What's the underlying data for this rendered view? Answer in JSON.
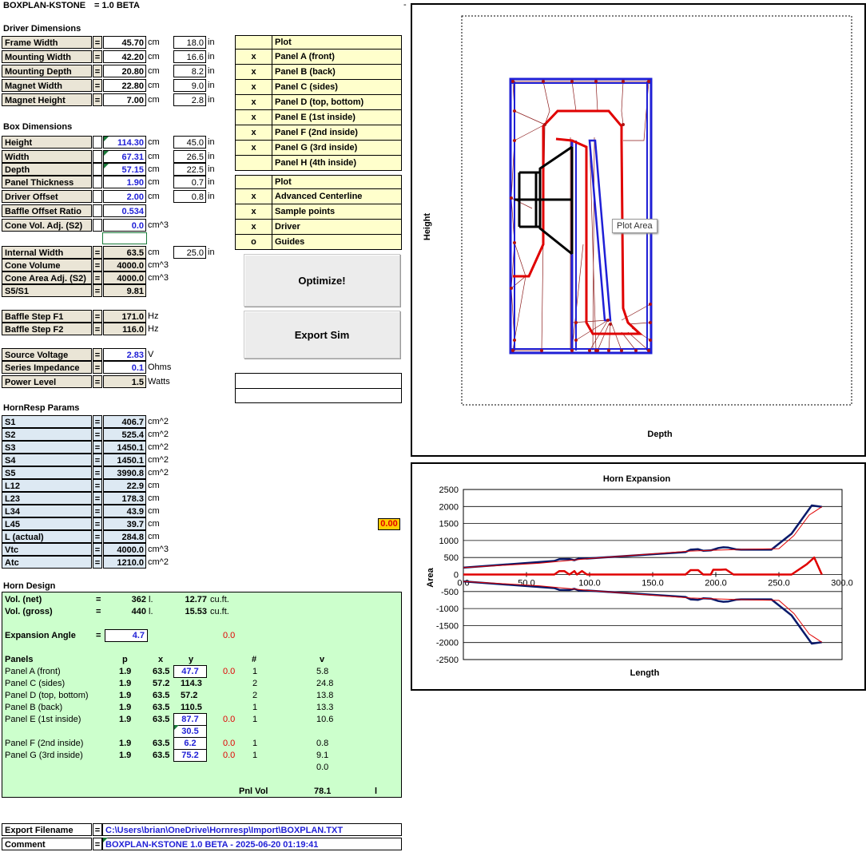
{
  "title": {
    "app": "BOXPLAN-KSTONE",
    "version": "= 1.0 BETA",
    "dash": "-"
  },
  "driver": {
    "heading": "Driver Dimensions",
    "rows": [
      {
        "label": "Frame Width",
        "eq": "=",
        "cm": "45.70",
        "unit": "cm",
        "inch": "18.0",
        "unit2": "in"
      },
      {
        "label": "Mounting Width",
        "eq": "=",
        "cm": "42.20",
        "unit": "cm",
        "inch": "16.6",
        "unit2": "in"
      },
      {
        "label": "Mounting Depth",
        "eq": "=",
        "cm": "20.80",
        "unit": "cm",
        "inch": "8.2",
        "unit2": "in"
      },
      {
        "label": "Magnet Width",
        "eq": "=",
        "cm": "22.80",
        "unit": "cm",
        "inch": "9.0",
        "unit2": "in"
      },
      {
        "label": "Magnet Height",
        "eq": "=",
        "cm": "7.00",
        "unit": "cm",
        "inch": "2.8",
        "unit2": "in"
      }
    ]
  },
  "box": {
    "heading": "Box Dimensions",
    "rows": [
      {
        "label": "Height",
        "cm": "114.30",
        "unit": "cm",
        "inch": "45.0",
        "unit2": "in"
      },
      {
        "label": "Width",
        "cm": "67.31",
        "unit": "cm",
        "inch": "26.5",
        "unit2": "in"
      },
      {
        "label": "Depth",
        "cm": "57.15",
        "unit": "cm",
        "inch": "22.5",
        "unit2": "in"
      },
      {
        "label": "Panel Thickness",
        "cm": "1.90",
        "unit": "cm",
        "inch": "0.7",
        "unit2": "in"
      },
      {
        "label": "Driver Offset",
        "cm": "2.00",
        "unit": "cm",
        "inch": "0.8",
        "unit2": "in"
      },
      {
        "label": "Baffle Offset Ratio",
        "cm": "0.534",
        "unit": "",
        "inch": "",
        "unit2": ""
      },
      {
        "label": "Cone Vol. Adj. (S2)",
        "cm": "0.0",
        "unit": "cm^3",
        "inch": "",
        "unit2": ""
      }
    ]
  },
  "derived": [
    {
      "label": "Internal Width",
      "eq": "=",
      "val": "63.5",
      "unit": "cm",
      "inch": "25.0",
      "unit2": "in"
    },
    {
      "label": "Cone Volume",
      "eq": "=",
      "val": "4000.0",
      "unit": "cm^3"
    },
    {
      "label": "Cone Area Adj. (S2)",
      "eq": "=",
      "val": "4000.0",
      "unit": "cm^3"
    },
    {
      "label": "S5/S1",
      "eq": "=",
      "val": "9.81",
      "unit": ""
    }
  ],
  "baffle": [
    {
      "label": "Baffle Step F1",
      "eq": "=",
      "val": "171.0",
      "unit": "Hz"
    },
    {
      "label": "Baffle Step F2",
      "eq": "=",
      "val": "116.0",
      "unit": "Hz"
    }
  ],
  "electrical": [
    {
      "label": "Source Voltage",
      "eq": "=",
      "val": "2.83",
      "unit": "V"
    },
    {
      "label": "Series Impedance",
      "eq": "=",
      "val": "0.1",
      "unit": "Ohms"
    },
    {
      "label": "Power Level",
      "eq": "=",
      "val": "1.5",
      "unit": "Watts"
    }
  ],
  "hornresp": {
    "heading": "HornResp Params",
    "rows": [
      {
        "label": "S1",
        "eq": "=",
        "val": "406.7",
        "unit": "cm^2"
      },
      {
        "label": "S2",
        "eq": "=",
        "val": "525.4",
        "unit": "cm^2"
      },
      {
        "label": "S3",
        "eq": "=",
        "val": "1450.1",
        "unit": "cm^2"
      },
      {
        "label": "S4",
        "eq": "=",
        "val": "1450.1",
        "unit": "cm^2"
      },
      {
        "label": "S5",
        "eq": "=",
        "val": "3990.8",
        "unit": "cm^2"
      },
      {
        "label": "L12",
        "eq": "=",
        "val": "22.9",
        "unit": "cm"
      },
      {
        "label": "L23",
        "eq": "=",
        "val": "178.3",
        "unit": "cm"
      },
      {
        "label": "L34",
        "eq": "=",
        "val": "43.9",
        "unit": "cm"
      },
      {
        "label": "L45",
        "eq": "=",
        "val": "39.7",
        "unit": "cm"
      },
      {
        "label": "L (actual)",
        "eq": "=",
        "val": "284.8",
        "unit": "cm"
      },
      {
        "label": "Vtc",
        "eq": "=",
        "val": "4000.0",
        "unit": "cm^3"
      },
      {
        "label": "Atc",
        "eq": "=",
        "val": "1210.0",
        "unit": "cm^2"
      }
    ],
    "badge": "0.00"
  },
  "plot1": {
    "heading": "Plot",
    "rows": [
      {
        "mark": "x",
        "label": "Panel A (front)"
      },
      {
        "mark": "x",
        "label": "Panel B (back)"
      },
      {
        "mark": "x",
        "label": "Panel C (sides)"
      },
      {
        "mark": "x",
        "label": "Panel D (top, bottom)"
      },
      {
        "mark": "x",
        "label": "Panel E (1st inside)"
      },
      {
        "mark": "x",
        "label": "Panel F (2nd inside)"
      },
      {
        "mark": "x",
        "label": "Panel G (3rd inside)"
      },
      {
        "mark": "",
        "label": "Panel H (4th inside)"
      }
    ]
  },
  "plot2": {
    "heading": "Plot",
    "rows": [
      {
        "mark": "x",
        "label": "Advanced Centerline"
      },
      {
        "mark": "x",
        "label": "Sample points"
      },
      {
        "mark": "x",
        "label": "Driver"
      },
      {
        "mark": "o",
        "label": "Guides"
      }
    ]
  },
  "buttons": {
    "optimize": "Optimize!",
    "export": "Export Sim"
  },
  "horn_design": {
    "heading": "Horn Design",
    "vol_net": {
      "label": "Vol. (net)",
      "eq": "=",
      "l": "362",
      "lu": "l.",
      "ft": "12.77",
      "ftu": "cu.ft."
    },
    "vol_gross": {
      "label": "Vol. (gross)",
      "eq": "=",
      "l": "440",
      "lu": "l.",
      "ft": "15.53",
      "ftu": "cu.ft."
    },
    "angle": {
      "label": "Expansion Angle",
      "eq": "=",
      "val": "4.7",
      "delta": "0.0"
    },
    "cols": {
      "panels": "Panels",
      "p": "p",
      "x": "x",
      "y": "y",
      "n": "#",
      "v": "v"
    },
    "panels": [
      {
        "name": "Panel A (front)",
        "p": "1.9",
        "x": "63.5",
        "y": "47.7",
        "d": "0.0",
        "n": "1",
        "v": "5.8",
        "edit": true
      },
      {
        "name": "Panel C (sides)",
        "p": "1.9",
        "x": "57.2",
        "y": "114.3",
        "d": "",
        "n": "2",
        "v": "24.8",
        "edit": false
      },
      {
        "name": "Panel D (top, bottom)",
        "p": "1.9",
        "x": "63.5",
        "y": "57.2",
        "d": "",
        "n": "2",
        "v": "13.8",
        "edit": false
      },
      {
        "name": "Panel B (back)",
        "p": "1.9",
        "x": "63.5",
        "y": "110.5",
        "d": "",
        "n": "1",
        "v": "13.3",
        "edit": false
      },
      {
        "name": "Panel E (1st inside)",
        "p": "1.9",
        "x": "63.5",
        "y": "87.7",
        "d": "0.0",
        "n": "1",
        "v": "10.6",
        "edit": true
      },
      {
        "name": "",
        "p": "",
        "x": "",
        "y": "30.5",
        "d": "",
        "n": "",
        "v": "",
        "edit": true
      },
      {
        "name": "Panel F (2nd inside)",
        "p": "1.9",
        "x": "63.5",
        "y": "6.2",
        "d": "0.0",
        "n": "1",
        "v": "0.8",
        "edit": true
      },
      {
        "name": "Panel G (3rd inside)",
        "p": "1.9",
        "x": "63.5",
        "y": "75.2",
        "d": "0.0",
        "n": "1",
        "v": "9.1",
        "edit": true
      },
      {
        "name": "",
        "p": "",
        "x": "",
        "y": "",
        "d": "",
        "n": "",
        "v": "0.0",
        "edit": false
      }
    ],
    "pnl_vol": {
      "label": "Pnl Vol",
      "val": "78.1",
      "unit": "l"
    }
  },
  "export": {
    "filename_label": "Export Filename",
    "filename": "C:\\Users\\brian\\OneDrive\\Hornresp\\Import\\BOXPLAN.TXT",
    "comment_label": "Comment",
    "comment": "BOXPLAN-KSTONE 1.0 BETA - 2025-06-20 01:19:41",
    "eq": "="
  },
  "side_chart": {
    "xlabel": "Depth",
    "ylabel": "Height",
    "tooltip": "Plot Area"
  },
  "colors": {
    "blue": "#1f1fd6",
    "red": "#e00000",
    "navy": "#0a1a6a",
    "green_panel": "#ccffcc",
    "plot_bg": "#ffffcc"
  },
  "chart_data": {
    "type": "line",
    "title": "Horn Expansion",
    "xlabel": "Length",
    "ylabel": "Area",
    "xlim": [
      0,
      300
    ],
    "ylim": [
      -2500,
      2500
    ],
    "xticks": [
      "0.0",
      "50.0",
      "100.0",
      "150.0",
      "200.0",
      "250.0",
      "300.0"
    ],
    "yticks": [
      "2500",
      "2000",
      "1500",
      "1000",
      "500",
      "0",
      "-500",
      "-1000",
      "-1500",
      "-2000",
      "-2500"
    ],
    "grid": true,
    "series": [
      {
        "color": "#0a1a6a",
        "x": [
          0,
          72,
          76,
          84,
          88,
          92,
          98,
          176,
          180,
          186,
          190,
          196,
          202,
          206,
          210,
          216,
          220,
          232,
          244,
          260,
          276,
          284
        ],
        "y": [
          203,
          400,
          450,
          455,
          420,
          475,
          470,
          660,
          730,
          745,
          700,
          710,
          780,
          800,
          790,
          740,
          730,
          730,
          730,
          1200,
          2030,
          1990
        ]
      },
      {
        "color": "#e00000",
        "x": [
          0,
          60,
          100,
          140,
          180,
          220,
          250,
          262,
          274,
          284
        ],
        "y": [
          203,
          330,
          470,
          580,
          690,
          740,
          760,
          1150,
          1750,
          1990
        ]
      },
      {
        "color": "#e00000",
        "x": [
          0,
          72,
          76,
          80,
          84,
          88,
          90,
          94,
          98,
          176,
          180,
          186,
          190,
          196,
          198,
          204,
          208,
          214,
          218,
          232,
          260,
          272,
          278,
          284
        ],
        "y": [
          0,
          0,
          100,
          100,
          0,
          100,
          0,
          100,
          0,
          0,
          130,
          130,
          0,
          0,
          140,
          140,
          150,
          0,
          0,
          0,
          0,
          300,
          500,
          0
        ]
      }
    ]
  }
}
